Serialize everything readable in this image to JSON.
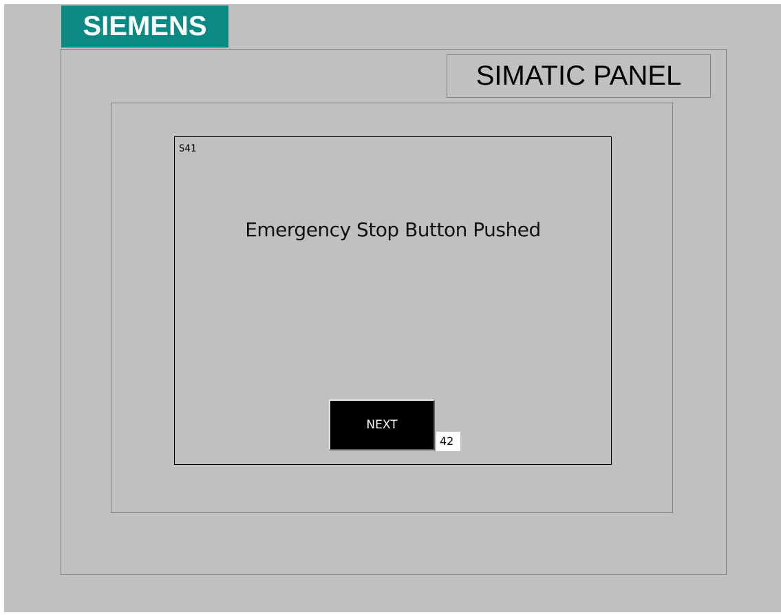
{
  "brand": {
    "logo_text": "SIEMENS",
    "logo_color": "#0a8a83"
  },
  "panel": {
    "title": "SIMATIC PANEL"
  },
  "screen": {
    "id": "S41",
    "message": "Emergency Stop Button Pushed",
    "next_button_label": "NEXT",
    "counter_value": "42"
  },
  "colors": {
    "background": "#c0c0c0",
    "button_background": "#000000",
    "button_text": "#ffffff"
  }
}
